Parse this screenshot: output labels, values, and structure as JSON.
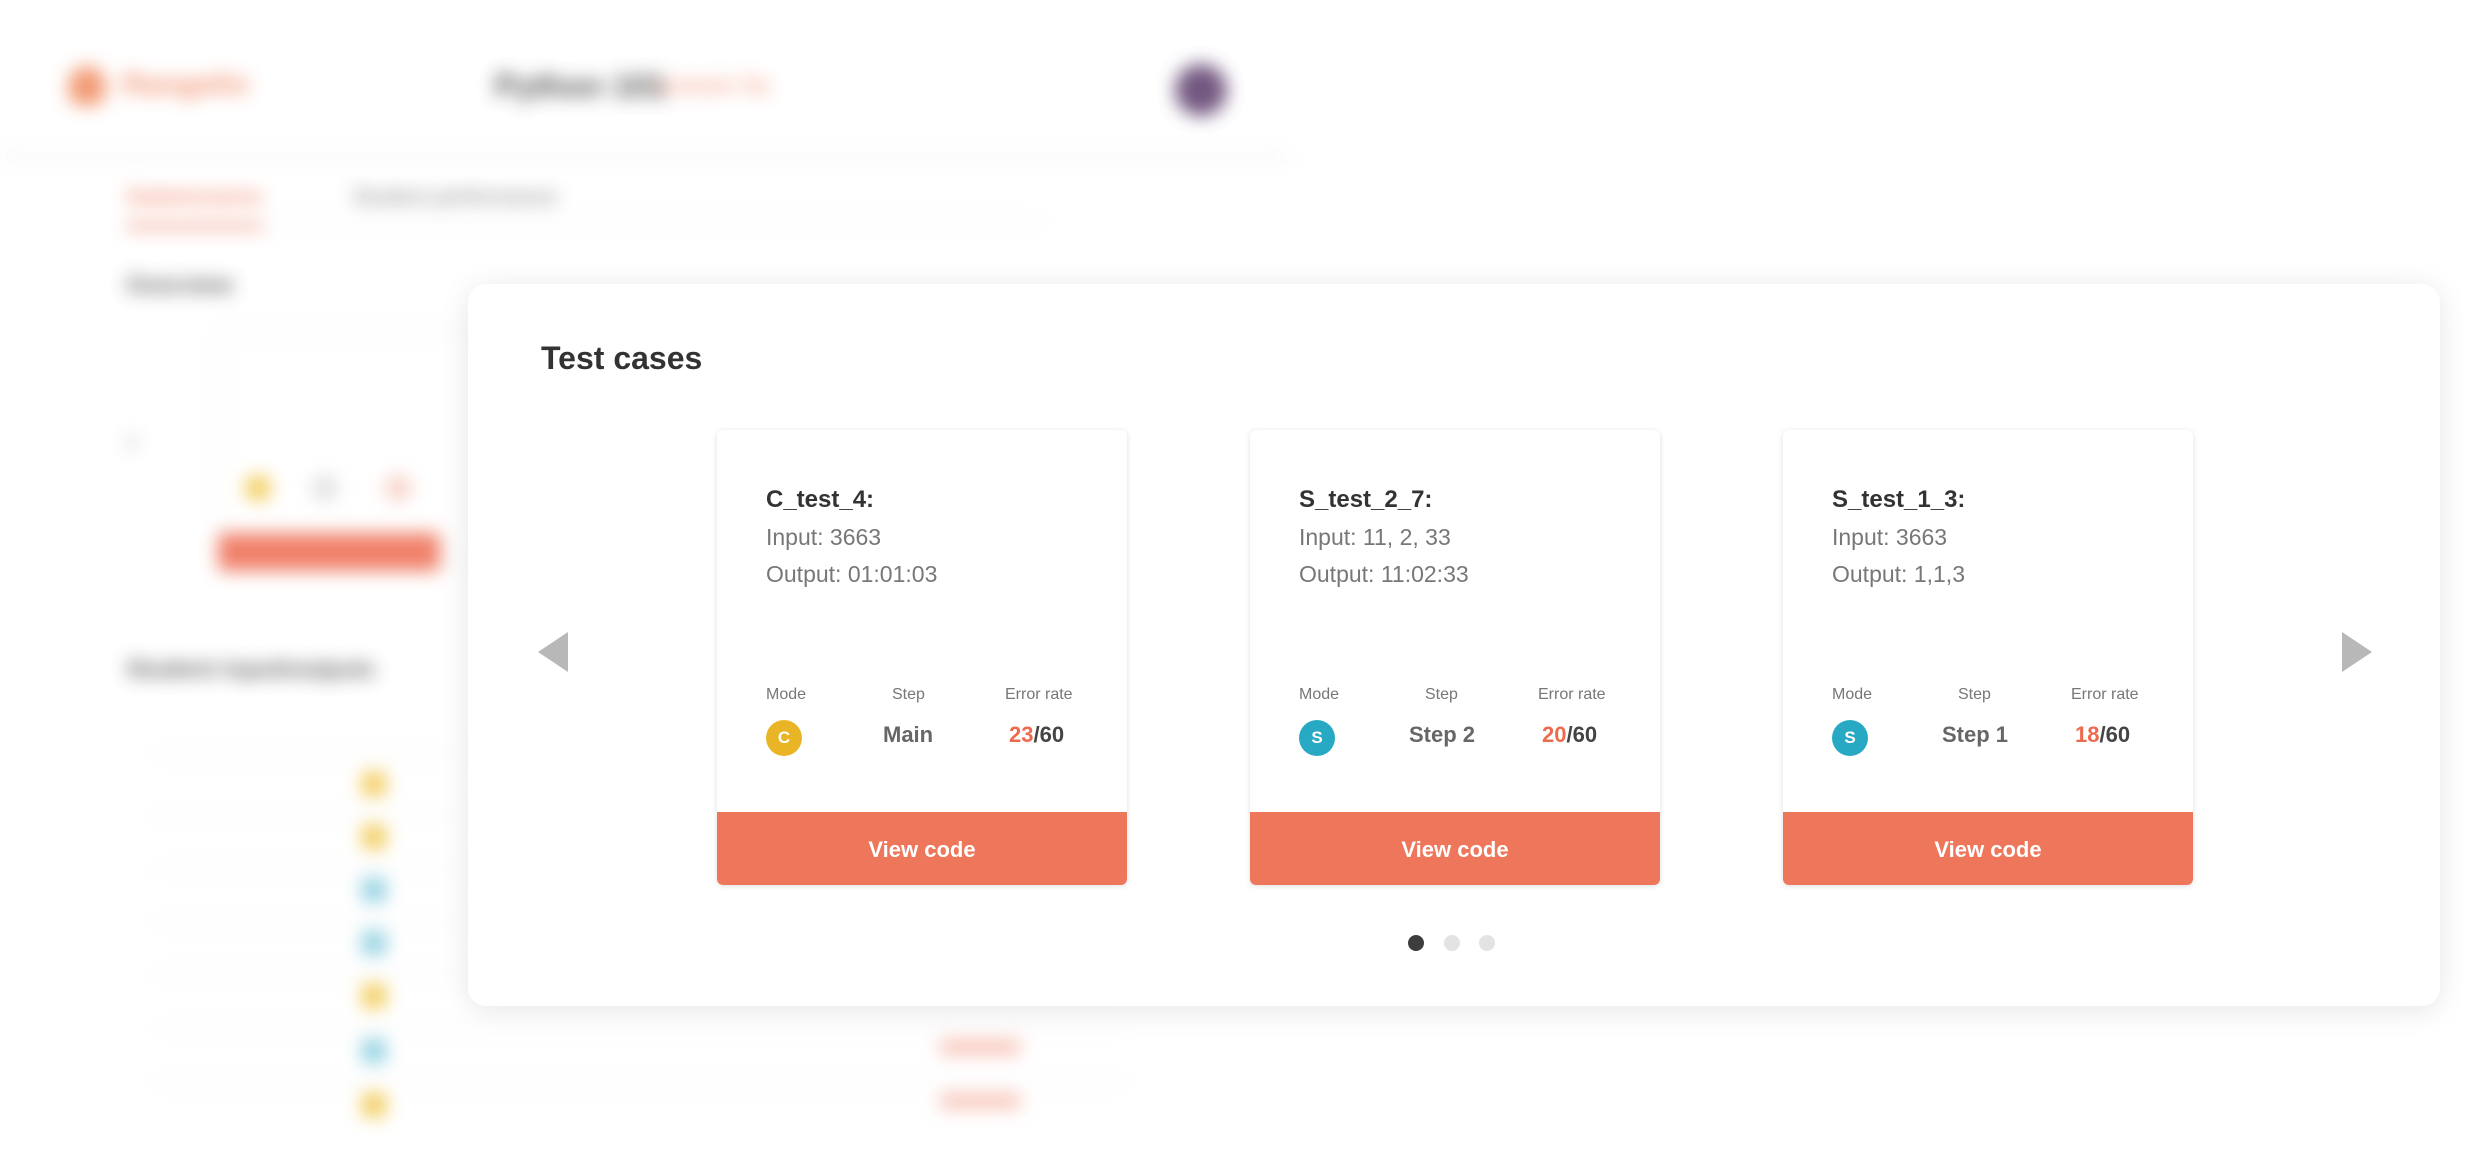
{
  "background": {
    "logo_text": "Rangelin",
    "course_title": "Python 101",
    "course_tag": "Lesson 5a",
    "tabs": [
      "Submissions",
      "Student performance"
    ],
    "section_title_1": "Overview",
    "section_title_2": "Student input/outputs"
  },
  "modal": {
    "title": "Test cases",
    "prev_label": "previous",
    "next_label": "next",
    "cards": [
      {
        "name": "C_test_4:",
        "input": "Input: 3663",
        "output": "Output: 01:01:03",
        "mode_label": "Mode",
        "mode_letter": "C",
        "mode_color": "#e9b527",
        "step_label": "Step",
        "step_value": "Main",
        "error_label": "Error rate",
        "error_count": "23",
        "error_total": "/60",
        "button": "View code"
      },
      {
        "name": "S_test_2_7:",
        "input": "Input: 11, 2, 33",
        "output": "Output: 11:02:33",
        "mode_label": "Mode",
        "mode_letter": "S",
        "mode_color": "#27a9c4",
        "step_label": "Step",
        "step_value": "Step 2",
        "error_label": "Error rate",
        "error_count": "20",
        "error_total": "/60",
        "button": "View code"
      },
      {
        "name": "S_test_1_3:",
        "input": "Input: 3663",
        "output": "Output: 1,1,3",
        "mode_label": "Mode",
        "mode_letter": "S",
        "mode_color": "#27a9c4",
        "step_label": "Step",
        "step_value": "Step 1",
        "error_label": "Error rate",
        "error_count": "18",
        "error_total": "/60",
        "button": "View code"
      }
    ],
    "pagination": {
      "total": 3,
      "active": 1
    }
  },
  "colors": {
    "accent": "#ee765a",
    "error_highlight": "#ee6a4f",
    "mode_c": "#e9b527",
    "mode_s": "#27a9c4"
  }
}
